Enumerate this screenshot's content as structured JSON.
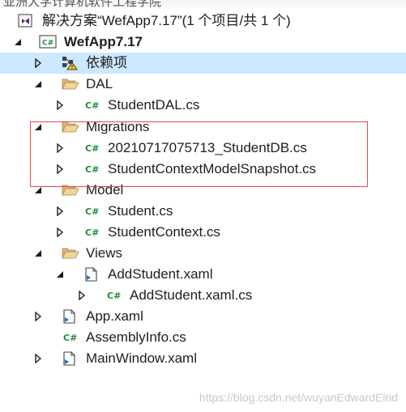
{
  "top_cut_text": "亚洲大学计算机软件工程学院",
  "solution": {
    "label": "解决方案“WefApp7.17”(1 个项目/共 1 个)",
    "icon": "visual-studio-icon"
  },
  "project": {
    "label": "WefApp7.17",
    "icon": "csharp-project-icon"
  },
  "items": {
    "deps": {
      "label": "依赖项",
      "icon": "dependencies-warning-icon"
    },
    "dal": {
      "label": "DAL",
      "icon": "folder-open-icon"
    },
    "studentdal": {
      "label": "StudentDAL.cs",
      "icon": "csharp-file-icon"
    },
    "migrations": {
      "label": "Migrations",
      "icon": "folder-open-icon"
    },
    "migration_file": {
      "label": "20210717075713_StudentDB.cs",
      "icon": "csharp-file-icon"
    },
    "snapshot": {
      "label": "StudentContextModelSnapshot.cs",
      "icon": "csharp-file-icon"
    },
    "model": {
      "label": "Model",
      "icon": "folder-open-icon"
    },
    "student": {
      "label": "Student.cs",
      "icon": "csharp-file-icon"
    },
    "studentcontext": {
      "label": "StudentContext.cs",
      "icon": "csharp-file-icon"
    },
    "views": {
      "label": "Views",
      "icon": "folder-open-icon"
    },
    "addstudent": {
      "label": "AddStudent.xaml",
      "icon": "xaml-file-icon"
    },
    "addstudent_cs": {
      "label": "AddStudent.xaml.cs",
      "icon": "csharp-file-icon"
    },
    "app": {
      "label": "App.xaml",
      "icon": "xaml-file-icon"
    },
    "assemblyinfo": {
      "label": "AssemblyInfo.cs",
      "icon": "csharp-file-icon"
    },
    "mainwindow": {
      "label": "MainWindow.xaml",
      "icon": "xaml-file-icon"
    }
  },
  "watermark": "https://blog.csdn.net/wuyanEdwardElrid",
  "colors": {
    "selection": "#cce8ff",
    "highlight_border": "#e04a4a",
    "csharp_green": "#1f8d3a",
    "folder": "#dcb67a",
    "vs_purple": "#68217a"
  }
}
